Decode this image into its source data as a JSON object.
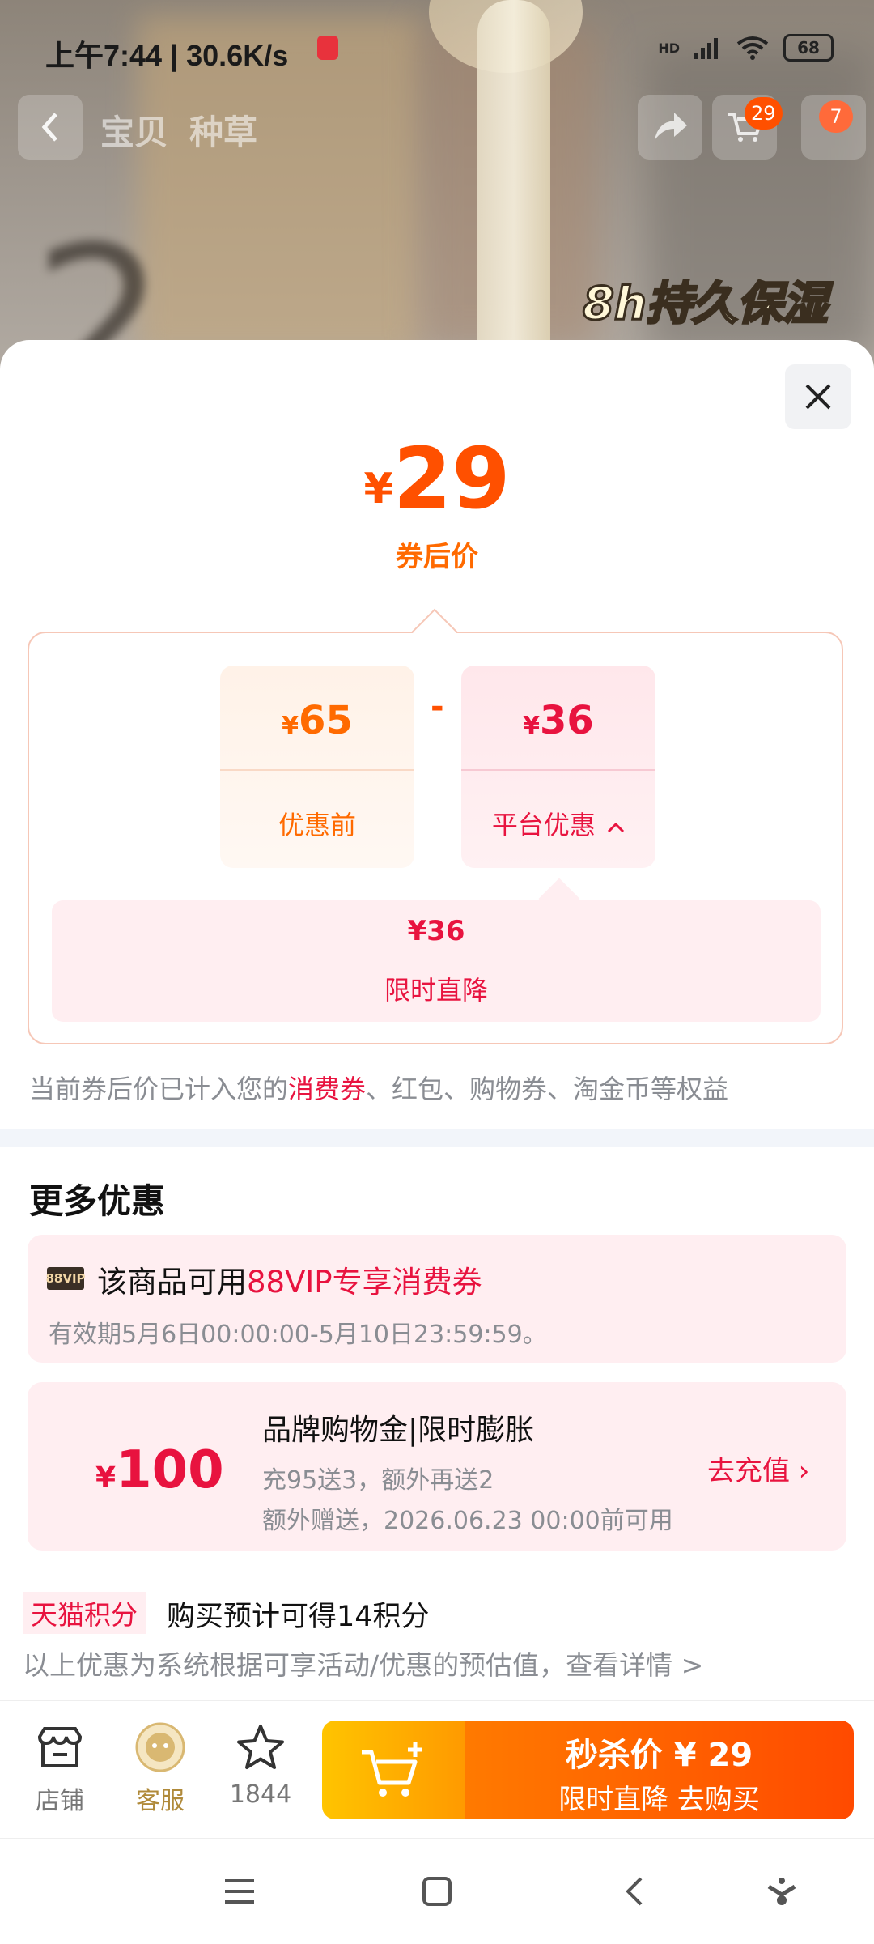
{
  "status_bar": {
    "time_speed": "上午7:44 | 30.6K/s",
    "network": "HD",
    "battery": "68"
  },
  "header": {
    "tabs": [
      "宝贝",
      "种草"
    ],
    "cart_badge": "29",
    "more_badge": "7"
  },
  "product_overlay": {
    "text": "8h持久保湿",
    "digit": "2"
  },
  "price_sheet": {
    "currency": "¥",
    "after_coupon_price": "29",
    "after_coupon_label": "券后价",
    "before_price": "65",
    "before_label": "优惠前",
    "minus": "-",
    "platform_discount": "36",
    "platform_label": "平台优惠",
    "limited_cut_value": "¥36",
    "limited_cut_label": "限时直降",
    "note_prefix": "当前券后价已计入您的",
    "note_highlight": "消费券",
    "note_suffix": "、红包、购物券、淘金币等权益"
  },
  "more_offers": {
    "title": "更多优惠",
    "vip_icon_text": "88VIP",
    "vip_prefix": "该商品可用",
    "vip_highlight": "88VIP专享消费券",
    "vip_validity": "有效期5月6日00:00:00-5月10日23:59:59。",
    "brand_amount_cur": "¥",
    "brand_amount": "100",
    "brand_title": "品牌购物金|限时膨胀",
    "brand_sub1": "充95送3，额外再送2",
    "brand_sub2": "额外赠送，2026.06.23 00:00前可用",
    "brand_action": "去充值 ›",
    "points_tag": "天猫积分",
    "points_text": "购买预计可得14积分",
    "estimate_note": "以上优惠为系统根据可享活动/优惠的预估值，查看详情 >"
  },
  "bottom_bar": {
    "store_label": "店铺",
    "service_label": "客服",
    "favorites_count": "1844",
    "buy_line1": "秒杀价 ¥ 29",
    "buy_line2": "限时直降  去购买"
  },
  "colors": {
    "brand_orange": "#ff5000",
    "discount_red": "#e8133f",
    "pink_bg": "#ffeef1"
  }
}
